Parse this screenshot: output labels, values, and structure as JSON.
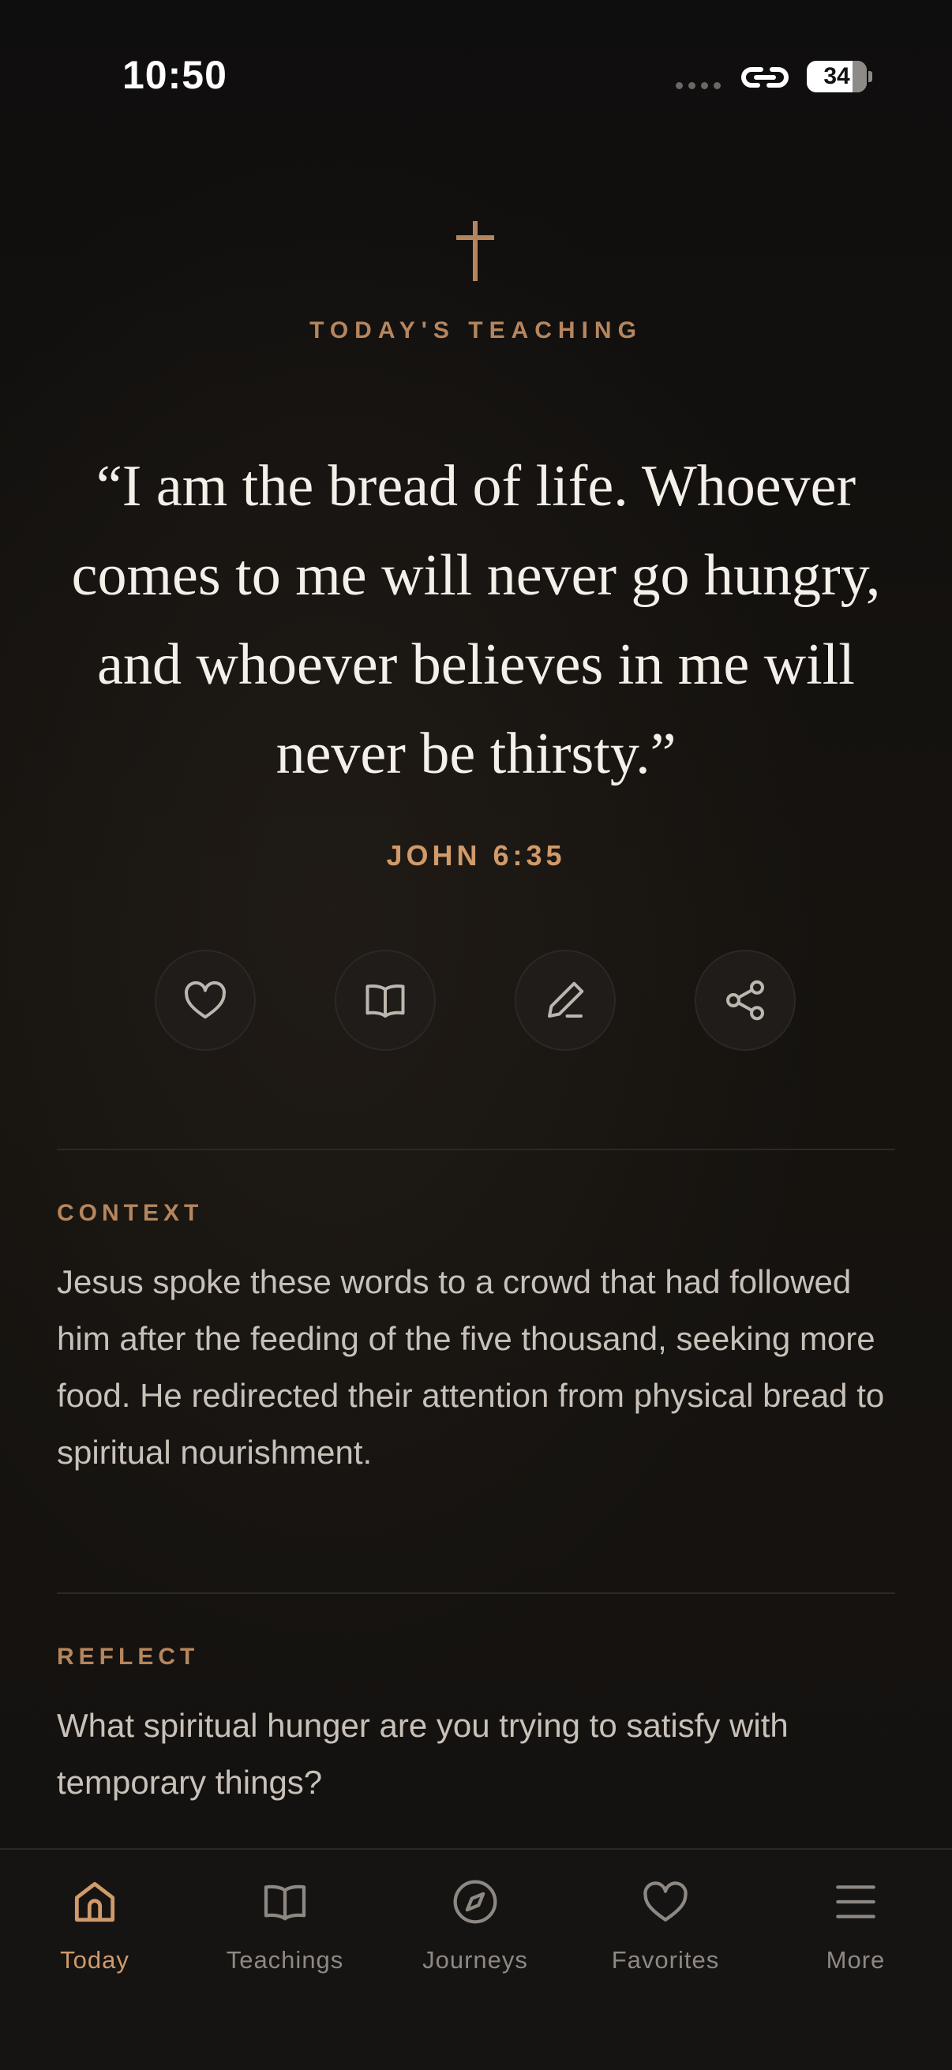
{
  "status_bar": {
    "time": "10:50",
    "battery": "34",
    "signal_icon": "signal-dots-icon",
    "link_icon": "link-icon"
  },
  "header": {
    "icon": "cross-icon",
    "eyebrow": "TODAY'S TEACHING"
  },
  "verse": {
    "text": "“I am the bread of life. Whoever comes to me will never go hungry, and whoever believes in me will never be thirsty.”",
    "reference": "JOHN 6:35"
  },
  "actions": [
    {
      "name": "favorite",
      "icon": "heart-icon"
    },
    {
      "name": "read",
      "icon": "book-open-icon"
    },
    {
      "name": "journal",
      "icon": "pencil-icon"
    },
    {
      "name": "share",
      "icon": "share-icon"
    }
  ],
  "context": {
    "label": "CONTEXT",
    "body": "Jesus spoke these words to a crowd that had followed him after the feeding of the five thousand, seeking more food. He redirected their attention from physical bread to spiritual nourishment."
  },
  "reflect": {
    "label": "REFLECT",
    "body": "What spiritual hunger are you trying to satisfy with temporary things?"
  },
  "tabs": [
    {
      "label": "Today",
      "icon": "home-icon",
      "active": true
    },
    {
      "label": "Teachings",
      "icon": "book-icon",
      "active": false
    },
    {
      "label": "Journeys",
      "icon": "compass-icon",
      "active": false
    },
    {
      "label": "Favorites",
      "icon": "heart-icon",
      "active": false
    },
    {
      "label": "More",
      "icon": "menu-icon",
      "active": false
    }
  ],
  "colors": {
    "background": "#131110",
    "accent": "#d09a6a",
    "accent_muted": "#b5865e",
    "text": "#f4efe8",
    "body_text": "#c8c1b9",
    "inactive": "#8e8883"
  }
}
